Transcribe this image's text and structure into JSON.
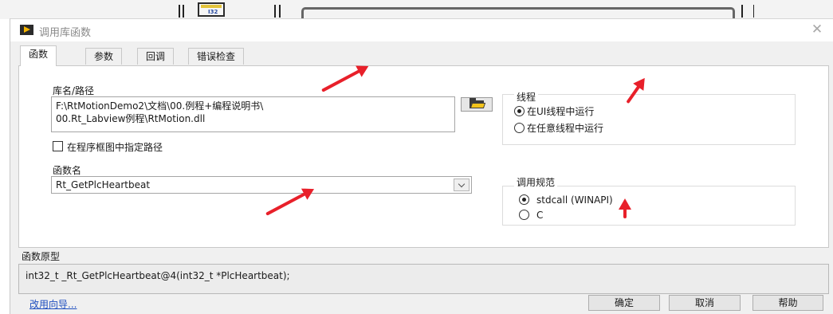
{
  "dialog": {
    "title": "调用库函数",
    "close_glyph": "✕"
  },
  "background": {
    "block_label": "I32"
  },
  "tabs": [
    {
      "label": "函数",
      "active": true
    },
    {
      "label": "参数",
      "active": false
    },
    {
      "label": "回调",
      "active": false
    },
    {
      "label": "错误检查",
      "active": false
    }
  ],
  "library": {
    "label": "库名/路径",
    "path_line1": "F:\\RtMotionDemo2\\文档\\00.例程+编程说明书\\",
    "path_line2": "00.Rt_Labview例程\\RtMotion.dll",
    "browse_icon": "folder-icon",
    "specify_path_label": "在程序框图中指定路径",
    "specify_path_checked": false
  },
  "function": {
    "label": "函数名",
    "value": "Rt_GetPlcHeartbeat"
  },
  "thread": {
    "label": "线程",
    "options": [
      {
        "label": "在UI线程中运行",
        "selected": true
      },
      {
        "label": "在任意线程中运行",
        "selected": false
      }
    ]
  },
  "calling_convention": {
    "label": "调用规范",
    "options": [
      {
        "label": "stdcall (WINAPI)",
        "selected": true
      },
      {
        "label": "C",
        "selected": false
      }
    ]
  },
  "prototype": {
    "label": "函数原型",
    "value": "int32_t _Rt_GetPlcHeartbeat@4(int32_t *PlcHeartbeat);"
  },
  "footer": {
    "wizard_link": "改用向导...",
    "ok_label": "确定",
    "cancel_label": "取消",
    "help_label": "帮助"
  },
  "annotation_color": "#e8202a"
}
